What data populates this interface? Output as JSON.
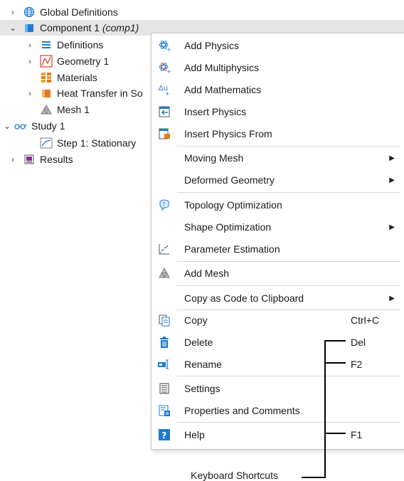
{
  "tree": {
    "global_definitions": "Global Definitions",
    "component_label": "Component 1",
    "component_tag": "(comp1)",
    "definitions": "Definitions",
    "geometry": "Geometry 1",
    "materials": "Materials",
    "heat_transfer": "Heat Transfer in So",
    "mesh": "Mesh 1",
    "study": "Study 1",
    "step": "Step 1: Stationary",
    "results": "Results"
  },
  "menu": {
    "add_physics": "Add Physics",
    "add_multiphysics": "Add Multiphysics",
    "add_mathematics": "Add Mathematics",
    "insert_physics": "Insert Physics",
    "insert_physics_from": "Insert Physics From",
    "moving_mesh": "Moving Mesh",
    "deformed_geometry": "Deformed Geometry",
    "topology_optimization": "Topology Optimization",
    "shape_optimization": "Shape Optimization",
    "parameter_estimation": "Parameter Estimation",
    "add_mesh": "Add Mesh",
    "copy_as_code": "Copy as Code to Clipboard",
    "copy": "Copy",
    "copy_shortcut": "Ctrl+C",
    "delete": "Delete",
    "delete_shortcut": "Del",
    "rename": "Rename",
    "rename_shortcut": "F2",
    "settings": "Settings",
    "properties_comments": "Properties and Comments",
    "help": "Help",
    "help_shortcut": "F1"
  },
  "callout": {
    "label": "Keyboard Shortcuts"
  },
  "colors": {
    "selection": "#e5e5e5",
    "accent_blue": "#1e7ad1",
    "accent_orange": "#e07a1f"
  }
}
